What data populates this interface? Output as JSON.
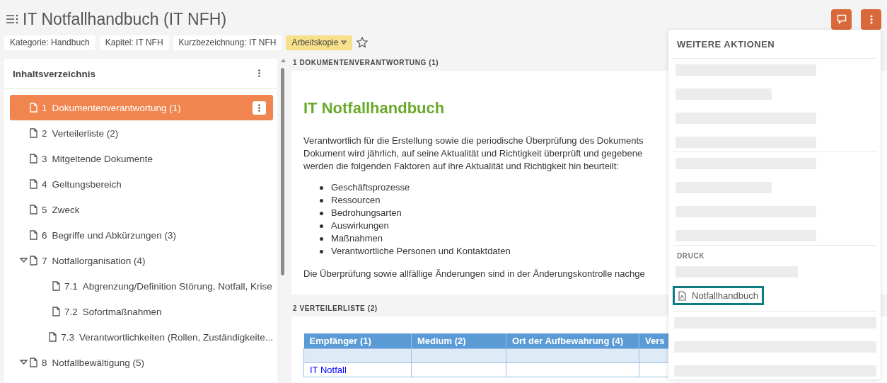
{
  "header": {
    "title": "IT Notfallhandbuch (IT NFH)"
  },
  "chips": [
    {
      "kind": "plain",
      "label": "Kategorie: Handbuch"
    },
    {
      "kind": "plain",
      "label": "Kapitel: IT NFH"
    },
    {
      "kind": "plain",
      "label": "Kurzbezeichnung: IT NFH"
    },
    {
      "kind": "status",
      "label": "Arbeitskopie"
    }
  ],
  "favorite": {
    "on": false
  },
  "toc": {
    "title": "Inhaltsverzeichnis",
    "items": [
      {
        "number": "1",
        "label": "Dokumentenverantwortung (1)",
        "selected": true
      },
      {
        "number": "2",
        "label": "Verteilerliste (2)",
        "selected": false
      },
      {
        "number": "3",
        "label": "Mitgeltende Dokumente",
        "selected": false
      },
      {
        "number": "4",
        "label": "Geltungsbereich",
        "selected": false
      },
      {
        "number": "5",
        "label": "Zweck",
        "selected": false
      },
      {
        "number": "6",
        "label": "Begriffe und Abkürzungen (3)",
        "selected": false
      },
      {
        "number": "7",
        "label": "Notfallorganisation (4)",
        "selected": false,
        "expanded": true,
        "children": [
          {
            "number": "7.1",
            "label": "Abgrenzung/Definition Störung, Notfall, Krise",
            "selected": false
          },
          {
            "number": "7.2",
            "label": "Sofortmaßnahmen",
            "selected": false
          },
          {
            "number": "7.3",
            "label": "Verantwortlichkeiten (Rollen, Zuständigkeite...",
            "selected": false
          }
        ]
      },
      {
        "number": "8",
        "label": "Notfallbewältigung (5)",
        "selected": false,
        "expanded": true
      }
    ]
  },
  "sections": [
    {
      "kind": "text",
      "heading": "1 DOKUMENTENVERANTWORTUNG (1)",
      "title": "IT Notfallhandbuch",
      "paragraph_lines": [
        "Verantwortlich für die Erstellung sowie die periodische Überprüfung des Dokuments",
        "Dokument wird jährlich, auf seine Aktualität und Richtigkeit überprüft und gegebene",
        "werden die folgenden Faktoren auf ihre Aktualität und Richtigkeit hin beurteilt:"
      ],
      "bullets": [
        "Geschäftsprozesse",
        "Ressourcen",
        "Bedrohungsarten",
        "Auswirkungen",
        "Maßnahmen",
        "Verantwortliche Personen und Kontaktdaten"
      ],
      "closing": "Die Überprüfung sowie allfällige Änderungen sind in der Änderungskontrolle nachge"
    },
    {
      "kind": "table",
      "heading": "2 VERTEILERLISTE (2)",
      "columns": [
        "Empfänger (1)",
        "Medium (2)",
        "Ort der Aufbewahrung (4)",
        "Vers"
      ],
      "rows": [
        [
          "",
          "",
          "",
          ""
        ],
        [
          "IT Notfall",
          "",
          "",
          ""
        ]
      ]
    }
  ],
  "menu": {
    "title": "WEITERE AKTIONEN",
    "section": "DRUCK",
    "item": {
      "label": "Notfallhandbuch",
      "focused": true
    }
  }
}
